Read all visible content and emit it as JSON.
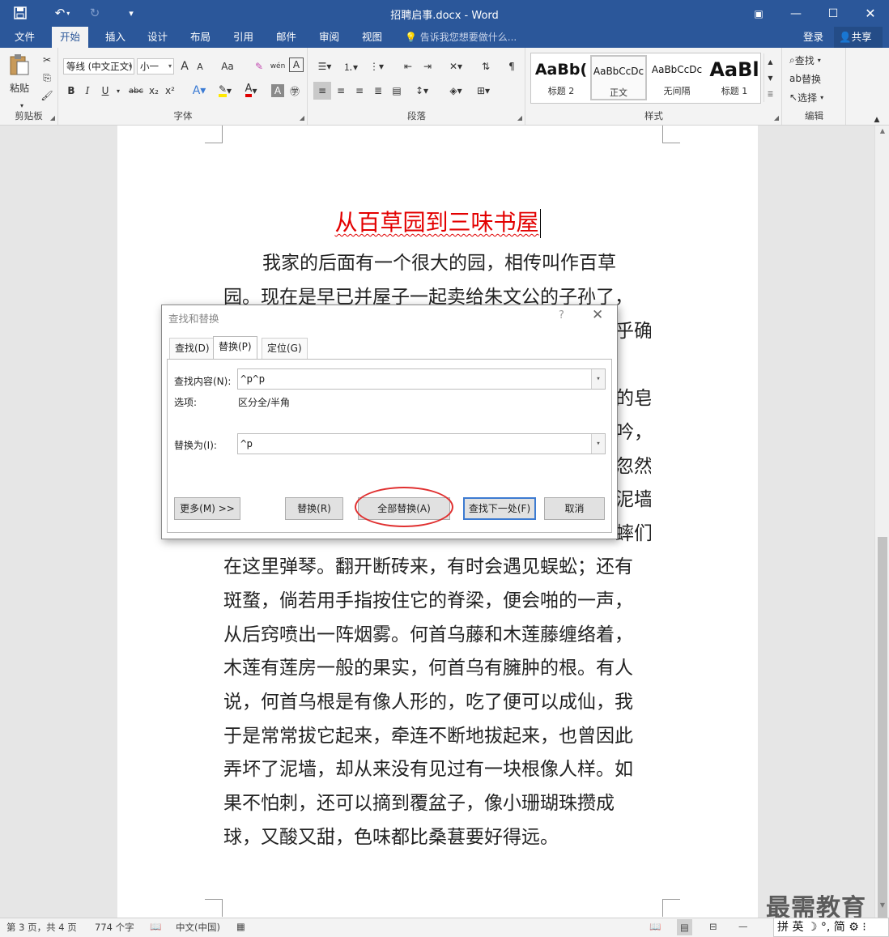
{
  "app": {
    "window_title": "招聘启事.docx - Word",
    "quick_access": [
      "save-icon",
      "undo-icon",
      "redo-icon",
      "customize-icon"
    ]
  },
  "tabs": {
    "items": [
      "文件",
      "开始",
      "插入",
      "设计",
      "布局",
      "引用",
      "邮件",
      "审阅",
      "视图"
    ],
    "active": "开始",
    "tell_me": "告诉我您想要做什么...",
    "login": "登录",
    "share": "共享"
  },
  "ribbon": {
    "clipboard": {
      "label": "剪贴板",
      "paste": "粘贴"
    },
    "font": {
      "label": "字体",
      "font_name": "等线 (中文正文)",
      "font_size": "小一",
      "bold": "B",
      "italic": "I",
      "underline": "U",
      "strike": "abc",
      "subscript": "x₂",
      "superscript": "x²",
      "grow": "A",
      "shrink": "A",
      "case": "Aa",
      "phonetic": "wén",
      "border": "A"
    },
    "paragraph": {
      "label": "段落"
    },
    "styles": {
      "label": "样式",
      "items": [
        {
          "preview": "AaBb(",
          "name": "标题 2"
        },
        {
          "preview": "AaBbCcDc",
          "name": "正文"
        },
        {
          "preview": "AaBbCcDc",
          "name": "无间隔"
        },
        {
          "preview": "AaBl",
          "name": "标题 1"
        }
      ]
    },
    "editing": {
      "label": "编辑",
      "find": "查找",
      "replace": "替换",
      "select": "选择"
    }
  },
  "document": {
    "title": "从百草园到三味书屋",
    "lines": [
      "我家的后面有一个很大的园，相传叫作百草",
      "园。现在是早已并屋子一起卖给朱文公的子孙了，",
      "在这里弹琴。翻开断砖来，有时会遇见蜈蚣；还有",
      "斑蝥，倘若用手指按住它的脊梁，便会啪的一声，",
      "从后窍喷出一阵烟雾。何首乌藤和木莲藤缠络着，",
      "木莲有莲房一般的果实，何首乌有臃肿的根。有人",
      "说，何首乌根是有像人形的，吃了便可以成仙，我",
      "于是常常拔它起来，牵连不断地拔起来，也曾因此",
      "弄坏了泥墙，却从来没有见过有一块根像人样。如",
      "果不怕刺，还可以摘到覆盆子，像小珊瑚珠攒成",
      "球，又酸又甜，色味都比桑葚要好得远。"
    ],
    "right_fragments": [
      "乎确",
      "的皂",
      "吟，",
      "忽然",
      "泥墙",
      "蟀们"
    ]
  },
  "dialog": {
    "title": "查找和替换",
    "help": "?",
    "tabs": [
      "查找(D)",
      "替换(P)",
      "定位(G)"
    ],
    "active_tab": "替换(P)",
    "find_label": "查找内容(N):",
    "find_value": "^p^p",
    "options_label": "选项:",
    "options_value": "区分全/半角",
    "replace_label": "替换为(I):",
    "replace_value": "^p",
    "buttons": {
      "more": "更多(M) >>",
      "replace": "替换(R)",
      "replace_all": "全部替换(A)",
      "find_next": "查找下一处(F)",
      "cancel": "取消"
    }
  },
  "status": {
    "page": "第 3 页，共 4 页",
    "words": "774 个字",
    "language": "中文(中国)",
    "ime": "拼 英 ☽ °, 简 ⚙ ⁝"
  },
  "watermark": "最需教育",
  "colors": {
    "brand": "#2b579a",
    "title_red": "#e30000",
    "highlight": "#e03030"
  }
}
